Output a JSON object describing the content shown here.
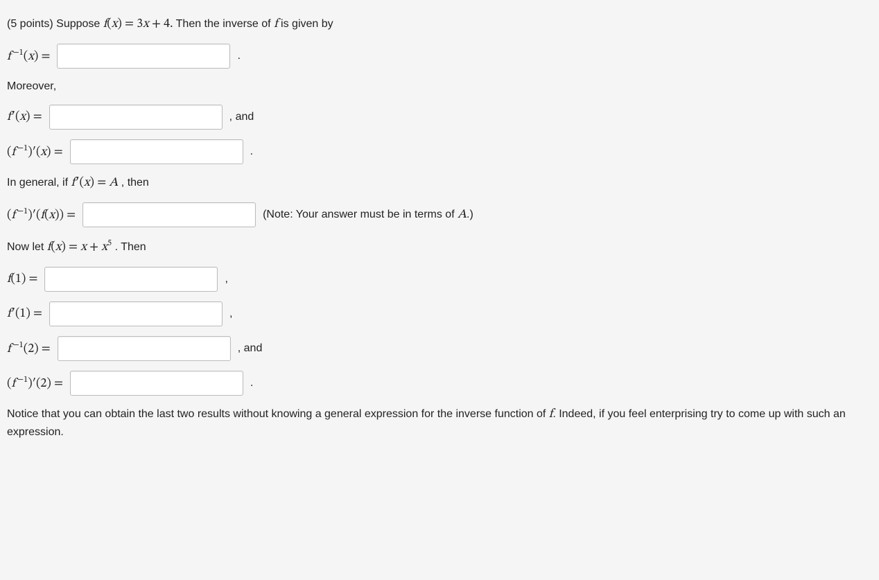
{
  "points_label": "(5 points) Suppose ",
  "intro_math": "f(x) = 3x + 4.",
  "intro_trailing": " Then the inverse of ",
  "intro_f": "f",
  "intro_end": " is given by",
  "line1_prefix": "f⁻¹(x) = ",
  "period": ".",
  "comma": ",",
  "moreover": "Moreover,",
  "line2_prefix": "f′(x) = ",
  "and": ", and",
  "line3_prefix": "(f⁻¹)′(x) = ",
  "ingeneral_a": "In general, if ",
  "ingeneral_math": "f′(x) = A",
  "ingeneral_b": ", then",
  "line4_prefix": "(f⁻¹)′(f(x)) = ",
  "note": "(Note: Your answer must be in terms of ",
  "note_A": "A",
  "note_end": ".)",
  "nowlet_a": "Now let ",
  "nowlet_math": "f(x) = x + x⁵",
  "nowlet_b": ". Then",
  "line5_prefix": "f(1) = ",
  "line6_prefix": "f′(1) = ",
  "line7_prefix": "f⁻¹(2) = ",
  "line8_prefix": "(f⁻¹)′(2) = ",
  "footer_a": "Notice that you can obtain the last two results without knowing a general expression for the inverse function of ",
  "footer_f": "f",
  "footer_b": ". Indeed, if you feel enterprising try to come up with such an expression."
}
